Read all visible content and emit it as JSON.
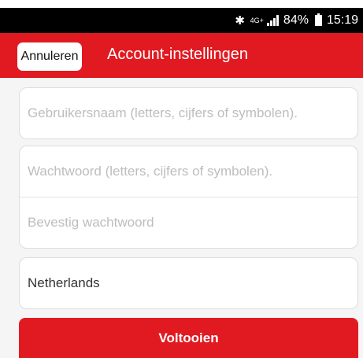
{
  "status_bar": {
    "bluetooth_icon": "bluetooth-icon",
    "network_label": "4G+",
    "signal_icon": "signal-icon",
    "battery_percent": "84%",
    "battery_icon": "battery-icon",
    "time": "15:19"
  },
  "header": {
    "cancel_label": "Annuleren",
    "title": "Account-instellingen",
    "background_color": "#e11a22"
  },
  "form": {
    "username_placeholder": "Gebruikersnaam (letters, cijfers of symbolen).",
    "password_placeholder": "Wachtwoord (letters, cijfers of symbolen).",
    "confirm_placeholder": "Bevestig wachtwoord",
    "country_value": "Netherlands"
  },
  "footer": {
    "submit_label": "Voltooien",
    "button_color": "#e11a22"
  }
}
